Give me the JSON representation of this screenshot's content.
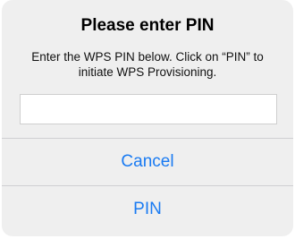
{
  "dialog": {
    "title": "Please enter PIN",
    "message": "Enter the WPS PIN below. Click on “PIN” to initiate WPS Provisioning.",
    "pin_value": "",
    "pin_placeholder": "",
    "cancel_label": "Cancel",
    "pin_label": "PIN"
  },
  "colors": {
    "background": "#efefef",
    "action_text": "#1a7bf2",
    "separator": "#cfcfd2"
  }
}
